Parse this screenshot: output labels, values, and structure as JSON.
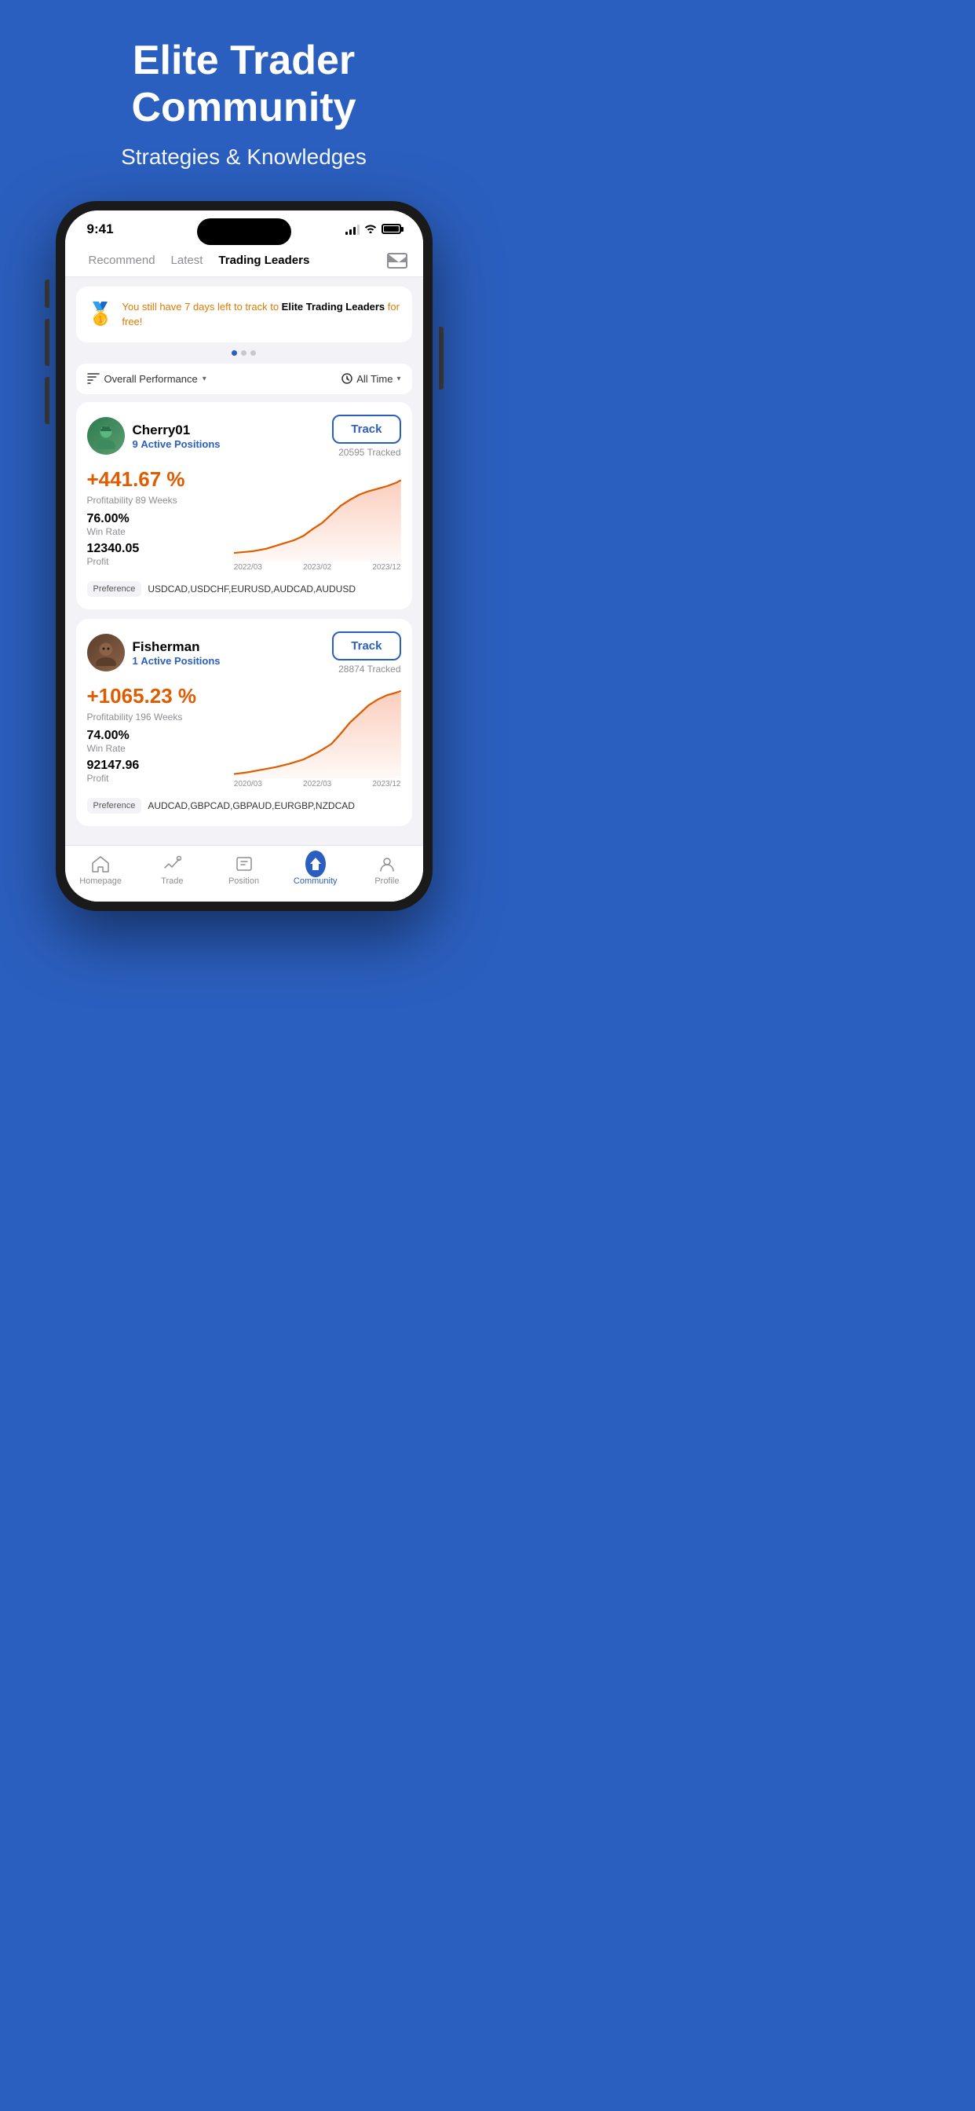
{
  "hero": {
    "title": "Elite Trader\nCommunity",
    "subtitle": "Strategies & Knowledges"
  },
  "status_bar": {
    "time": "9:41",
    "battery": 100
  },
  "nav_tabs": {
    "recommend": "Recommend",
    "latest": "Latest",
    "active": "Trading Leaders"
  },
  "banner": {
    "emoji": "🥇",
    "text_part1": "You still have 7 days left to track to",
    "text_bold": " Elite Trading Leaders",
    "text_part2": " for free!"
  },
  "filter": {
    "performance_label": "Overall Performance",
    "time_label": "All Time"
  },
  "traders": [
    {
      "name": "Cherry01",
      "active_positions_count": "9",
      "active_positions_label": "Active Positions",
      "track_label": "Track",
      "tracked_count": "20595 Tracked",
      "profit_pct": "+441.67 %",
      "profitability_label": "Profitability",
      "profitability_weeks": "89 Weeks",
      "win_rate": "76.00%",
      "win_rate_label": "Win Rate",
      "profit": "12340.05",
      "profit_label": "Profit",
      "chart_dates": [
        "2022/03",
        "2023/02",
        "2023/12"
      ],
      "preference_label": "Preference",
      "preferences": "USDCAD,USDCHF,EURUSD,AUDCAD,AUDUSD"
    },
    {
      "name": "Fisherman",
      "active_positions_count": "1",
      "active_positions_label": "Active Positions",
      "track_label": "Track",
      "tracked_count": "28874 Tracked",
      "profit_pct": "+1065.23 %",
      "profitability_label": "Profitability",
      "profitability_weeks": "196 Weeks",
      "win_rate": "74.00%",
      "win_rate_label": "Win Rate",
      "profit": "92147.96",
      "profit_label": "Profit",
      "chart_dates": [
        "2020/03",
        "2022/03",
        "2023/12"
      ],
      "preference_label": "Preference",
      "preferences": "AUDCAD,GBPCAD,GBPAUD,EURGBP,NZDCAD"
    }
  ],
  "bottom_nav": {
    "items": [
      {
        "id": "homepage",
        "label": "Homepage",
        "icon": "home-icon",
        "active": false
      },
      {
        "id": "trade",
        "label": "Trade",
        "icon": "trade-icon",
        "active": false
      },
      {
        "id": "position",
        "label": "Position",
        "icon": "position-icon",
        "active": false
      },
      {
        "id": "community",
        "label": "Community",
        "icon": "community-icon",
        "active": true
      },
      {
        "id": "profile",
        "label": "Profile",
        "icon": "profile-icon",
        "active": false
      }
    ]
  }
}
